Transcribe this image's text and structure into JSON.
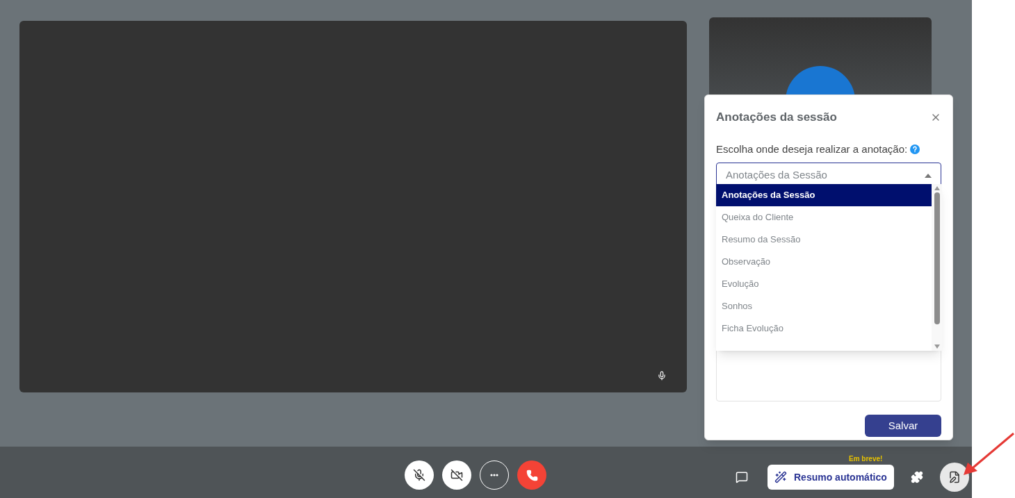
{
  "modal": {
    "title": "Anotações da sessão",
    "label": "Escolha onde deseja realizar a anotação:",
    "select": {
      "value": "Anotações da Sessão",
      "expanded": true
    },
    "options": [
      {
        "label": "Anotações da Sessão",
        "selected": true
      },
      {
        "label": "Queixa do Cliente",
        "selected": false
      },
      {
        "label": "Resumo da Sessão",
        "selected": false
      },
      {
        "label": "Observação",
        "selected": false
      },
      {
        "label": "Evolução",
        "selected": false
      },
      {
        "label": "Sonhos",
        "selected": false
      },
      {
        "label": "Ficha Evolução",
        "selected": false
      }
    ],
    "save_button": "Salvar"
  },
  "toolbar": {
    "controls": [
      {
        "kind": "mic"
      },
      {
        "kind": "camera"
      },
      {
        "kind": "more"
      },
      {
        "kind": "hangup"
      }
    ],
    "summary_button": "Resumo automático",
    "summary_badge": "Em breve!"
  }
}
